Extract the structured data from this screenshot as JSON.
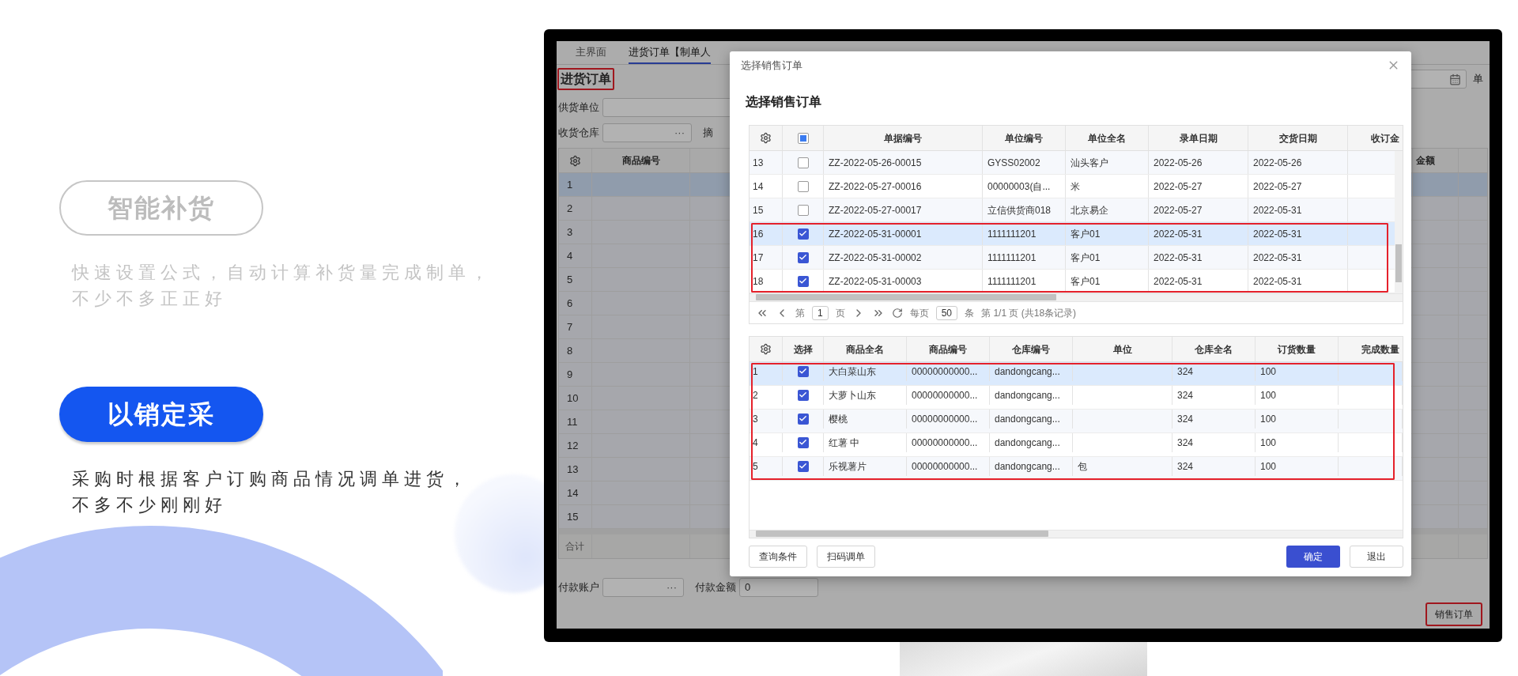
{
  "features": [
    {
      "title": "智能补货",
      "description": [
        "快速设置公式，自动计算补货量完成制单，",
        "不少不多正正好"
      ],
      "selected": false
    },
    {
      "title": "以销定采",
      "description": [
        "采购时根据客户订购商品情况调单进货，",
        "不多不少刚刚好"
      ],
      "selected": true
    }
  ],
  "app": {
    "tabs": [
      {
        "label": "主界面",
        "selected": false
      },
      {
        "label": "进货订单【制单人",
        "selected": true
      }
    ],
    "title": {
      "text": "进货订单",
      "highlighted": true
    },
    "supplier_label": "供货单位",
    "warehouse_label": "收货仓库",
    "warehouse_picker": "···",
    "summary_label": "摘",
    "date_suffix": "单",
    "table": {
      "columns": [
        "商品编号",
        "金额"
      ],
      "footer": "合计",
      "rows": [
        {
          "number": "1",
          "selected": true
        },
        {
          "number": "2",
          "selected": false
        },
        {
          "number": "3",
          "selected": false
        },
        {
          "number": "4",
          "selected": false
        },
        {
          "number": "5",
          "selected": false
        },
        {
          "number": "6",
          "selected": false
        },
        {
          "number": "7",
          "selected": false
        },
        {
          "number": "8",
          "selected": false
        },
        {
          "number": "9",
          "selected": false
        },
        {
          "number": "10",
          "selected": false
        },
        {
          "number": "11",
          "selected": false
        },
        {
          "number": "12",
          "selected": false
        },
        {
          "number": "13",
          "selected": false
        },
        {
          "number": "14",
          "selected": false
        },
        {
          "number": "15",
          "selected": false
        }
      ]
    },
    "payment_account_label": "付款账户",
    "payment_account_picker": "···",
    "payment_amount_label": "付款金额",
    "payment_amount_value": "0",
    "action_button": {
      "label": "销售订单",
      "highlighted": true
    }
  },
  "dialog": {
    "window_title": "选择销售订单",
    "heading": "选择销售订单",
    "orders": {
      "header_checkbox_indeterminate": true,
      "columns": [
        "单据编号",
        "单位编号",
        "单位全名",
        "录单日期",
        "交货日期",
        "收订金"
      ],
      "rows": [
        {
          "number": "13",
          "checked": false,
          "selected": false,
          "highlighted": false,
          "cells": [
            "ZZ-2022-05-26-00015",
            "GYSS02002",
            "汕头客户",
            "2022-05-26",
            "2022-05-26"
          ]
        },
        {
          "number": "14",
          "checked": false,
          "selected": false,
          "highlighted": false,
          "cells": [
            "ZZ-2022-05-27-00016",
            "00000003(自...",
            "米",
            "2022-05-27",
            "2022-05-27"
          ]
        },
        {
          "number": "15",
          "checked": false,
          "selected": false,
          "highlighted": false,
          "cells": [
            "ZZ-2022-05-27-00017",
            "立信供货商018",
            "北京易企",
            "2022-05-27",
            "2022-05-31"
          ]
        },
        {
          "number": "16",
          "checked": true,
          "selected": true,
          "highlighted": true,
          "cells": [
            "ZZ-2022-05-31-00001",
            "1111111201",
            "客户01",
            "2022-05-31",
            "2022-05-31"
          ]
        },
        {
          "number": "17",
          "checked": true,
          "selected": false,
          "highlighted": true,
          "cells": [
            "ZZ-2022-05-31-00002",
            "1111111201",
            "客户01",
            "2022-05-31",
            "2022-05-31"
          ]
        },
        {
          "number": "18",
          "checked": true,
          "selected": false,
          "highlighted": true,
          "cells": [
            "ZZ-2022-05-31-00003",
            "1111111201",
            "客户01",
            "2022-05-31",
            "2022-05-31"
          ]
        }
      ],
      "pager": {
        "page_prefix": "第",
        "page": "1",
        "page_suffix": "页",
        "per_page_prefix": "每页",
        "per_page": "50",
        "per_page_suffix": "条",
        "summary": "第 1/1 页 (共18条记录)"
      }
    },
    "items": {
      "select_column": "选择",
      "columns": [
        "商品全名",
        "商品编号",
        "仓库编号",
        "单位",
        "仓库全名",
        "订货数量",
        "完成数量"
      ],
      "rows": [
        {
          "number": "1",
          "checked": true,
          "selected": true,
          "highlighted": true,
          "cells": [
            "大白菜山东",
            "00000000000...",
            "dandongcang...",
            null,
            "324",
            "100",
            null
          ]
        },
        {
          "number": "2",
          "checked": true,
          "selected": false,
          "highlighted": true,
          "cells": [
            "大萝卜山东",
            "00000000000...",
            "dandongcang...",
            null,
            "324",
            "100",
            null
          ]
        },
        {
          "number": "3",
          "checked": true,
          "selected": false,
          "highlighted": true,
          "cells": [
            "樱桃",
            "00000000000...",
            "dandongcang...",
            null,
            "324",
            "100",
            null
          ]
        },
        {
          "number": "4",
          "checked": true,
          "selected": false,
          "highlighted": true,
          "cells": [
            "红薯 中",
            "00000000000...",
            "dandongcang...",
            null,
            "324",
            "100",
            null
          ]
        },
        {
          "number": "5",
          "checked": true,
          "selected": false,
          "highlighted": true,
          "cells": [
            "乐视薯片",
            "00000000000...",
            "dandongcang...",
            "包",
            "324",
            "100",
            null
          ]
        }
      ]
    },
    "left_buttons": [
      "查询条件",
      "扫码调单"
    ],
    "right_buttons": [
      {
        "label": "确定",
        "kind": "primary"
      },
      {
        "label": "退出",
        "kind": "default"
      }
    ]
  }
}
